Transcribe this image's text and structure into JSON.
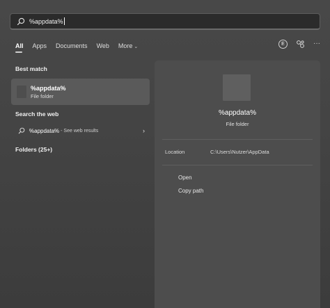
{
  "search": {
    "value": "%appdata%"
  },
  "tabs": [
    {
      "label": "All"
    },
    {
      "label": "Apps"
    },
    {
      "label": "Documents"
    },
    {
      "label": "Web"
    },
    {
      "label": "More"
    }
  ],
  "profile": {
    "initial": "E"
  },
  "sections": {
    "best_match": "Best match",
    "search_web": "Search the web",
    "folders": "Folders (25+)"
  },
  "best_match_item": {
    "title": "%appdata%",
    "subtitle": "File folder"
  },
  "web_result": {
    "query": "%appdata%",
    "suffix": "- See web results"
  },
  "preview": {
    "name": "%appdata%",
    "type": "File folder",
    "location_label": "Location",
    "location_value": "C:\\Users\\Nutzer\\AppData",
    "actions": [
      {
        "label": "Open"
      },
      {
        "label": "Copy path"
      }
    ]
  },
  "icons": {
    "search": "search-icon",
    "link": "link-icon",
    "more": "more-icon",
    "chevron_right": "chevron-right-icon",
    "chevron_down": "chevron-down-icon"
  }
}
